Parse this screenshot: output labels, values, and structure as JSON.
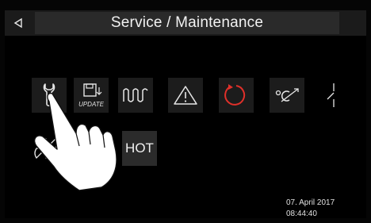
{
  "header": {
    "back_icon": "back-triangle-icon",
    "title": "Service / Maintenance"
  },
  "tiles": [
    {
      "name": "service-wrench",
      "icon": "wrench-icon"
    },
    {
      "name": "update",
      "icon": "floppy-update-icon",
      "label": "UPDATE"
    },
    {
      "name": "heating-curve",
      "icon": "wave-curve-icon"
    },
    {
      "name": "warnings",
      "icon": "warning-triangle-icon"
    },
    {
      "name": "reset",
      "icon": "circular-arrow-icon",
      "accent": "#e0302a"
    },
    {
      "name": "temperature-calibration",
      "icon": "celsius-arrow-icon"
    },
    {
      "name": "switch",
      "icon": "switch-icon"
    },
    {
      "name": "fan",
      "icon": "fan-icon"
    },
    {
      "name": "hot",
      "label": "HOT"
    }
  ],
  "status": {
    "date": "07. April 2017",
    "time": "08:44:40"
  }
}
